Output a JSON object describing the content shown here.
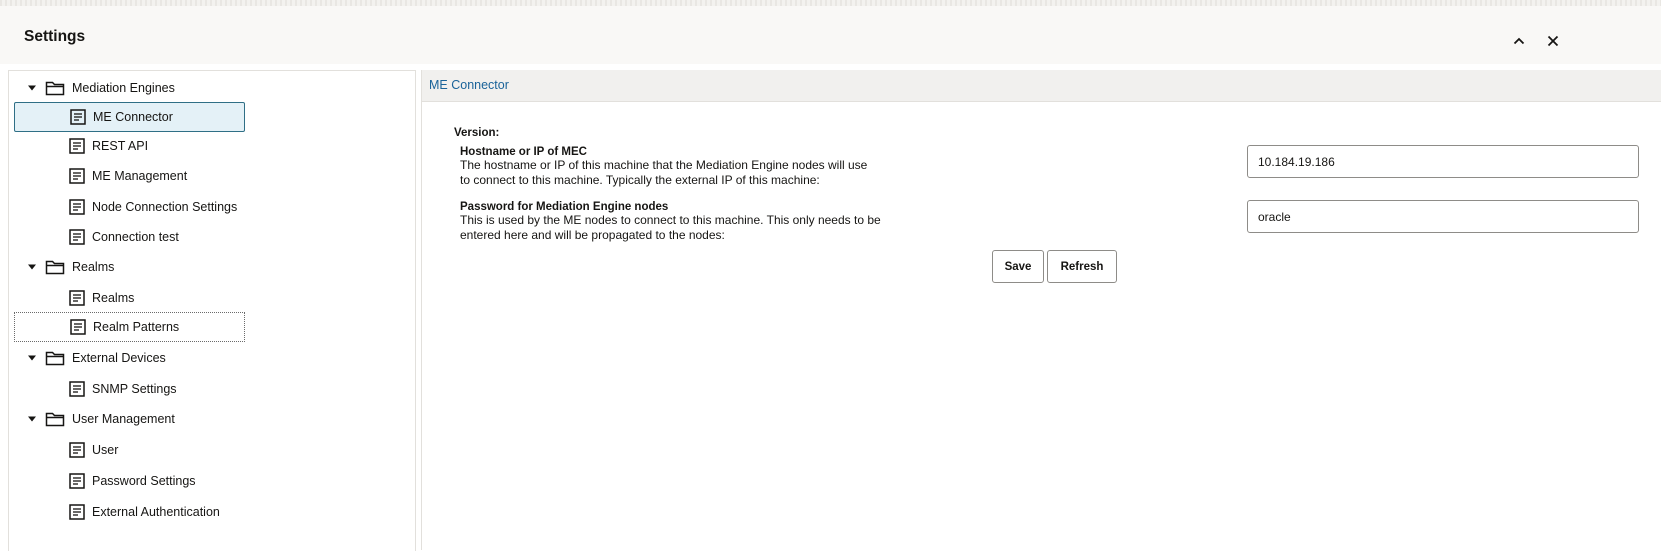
{
  "header": {
    "title": "Settings"
  },
  "tree": {
    "groups": [
      {
        "label": "Mediation Engines",
        "items": [
          "ME Connector",
          "REST API",
          "ME Management",
          "Node Connection Settings",
          "Connection test"
        ]
      },
      {
        "label": "Realms",
        "items": [
          "Realms",
          "Realm Patterns"
        ]
      },
      {
        "label": "External Devices",
        "items": [
          "SNMP Settings"
        ]
      },
      {
        "label": "User Management",
        "items": [
          "User",
          "Password Settings",
          "External Authentication"
        ]
      }
    ]
  },
  "panel": {
    "title": "ME Connector",
    "version_label": "Version:",
    "hostname": {
      "label": "Hostname or IP of MEC",
      "desc_line1": "The hostname or IP of this machine that the Mediation Engine nodes will use",
      "desc_line2": "to connect to this machine. Typically the external IP of this machine:",
      "value": "10.184.19.186"
    },
    "password": {
      "label": "Password for Mediation Engine nodes",
      "desc_line1": "This is used by the ME nodes to connect to this machine. This only needs to be",
      "desc_line2": "entered here and will be propagated to the nodes:",
      "value": "oracle"
    },
    "save_label": "Save",
    "refresh_label": "Refresh"
  }
}
